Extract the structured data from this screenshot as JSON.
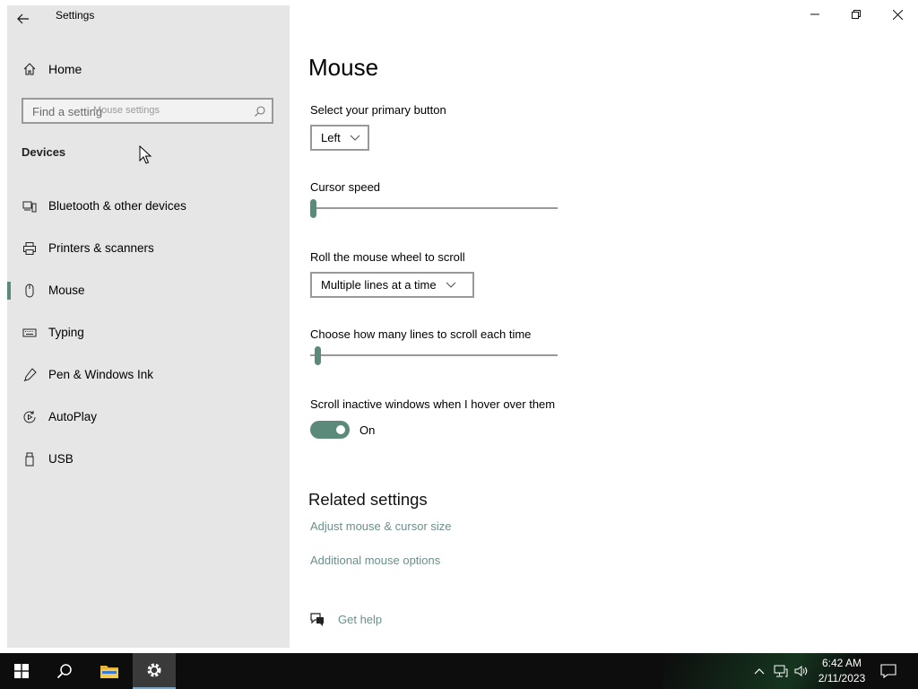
{
  "window": {
    "title": "Settings"
  },
  "sidebar": {
    "home_label": "Home",
    "search": {
      "placeholder": "Find a setting",
      "ghost_text": "Mouse settings"
    },
    "section_title": "Devices",
    "items": [
      {
        "label": "Bluetooth & other devices",
        "icon": "bluetooth-devices-icon"
      },
      {
        "label": "Printers & scanners",
        "icon": "printer-icon"
      },
      {
        "label": "Mouse",
        "icon": "mouse-icon",
        "active": true
      },
      {
        "label": "Typing",
        "icon": "keyboard-icon"
      },
      {
        "label": "Pen & Windows Ink",
        "icon": "pen-icon"
      },
      {
        "label": "AutoPlay",
        "icon": "autoplay-icon"
      },
      {
        "label": "USB",
        "icon": "usb-icon"
      }
    ]
  },
  "main": {
    "title": "Mouse",
    "primary_button": {
      "label": "Select your primary button",
      "value": "Left"
    },
    "cursor_speed": {
      "label": "Cursor speed",
      "value_fraction": 0.0
    },
    "wheel_scroll": {
      "label": "Roll the mouse wheel to scroll",
      "value": "Multiple lines at a time"
    },
    "lines_to_scroll": {
      "label": "Choose how many lines to scroll each time",
      "value_fraction": 0.02
    },
    "scroll_inactive": {
      "label": "Scroll inactive windows when I hover over them",
      "state": "On",
      "enabled": true
    },
    "related": {
      "heading": "Related settings",
      "links": [
        "Adjust mouse & cursor size",
        "Additional mouse options"
      ]
    },
    "help": {
      "label": "Get help"
    }
  },
  "taskbar": {
    "clock": {
      "time": "6:42 AM",
      "date": "2/11/2023"
    }
  },
  "colors": {
    "accent": "#5b8a7a",
    "link": "#6b8f8a",
    "sidebar_bg": "#e6e6e6",
    "taskbar_bg": "#0d0d0d"
  }
}
